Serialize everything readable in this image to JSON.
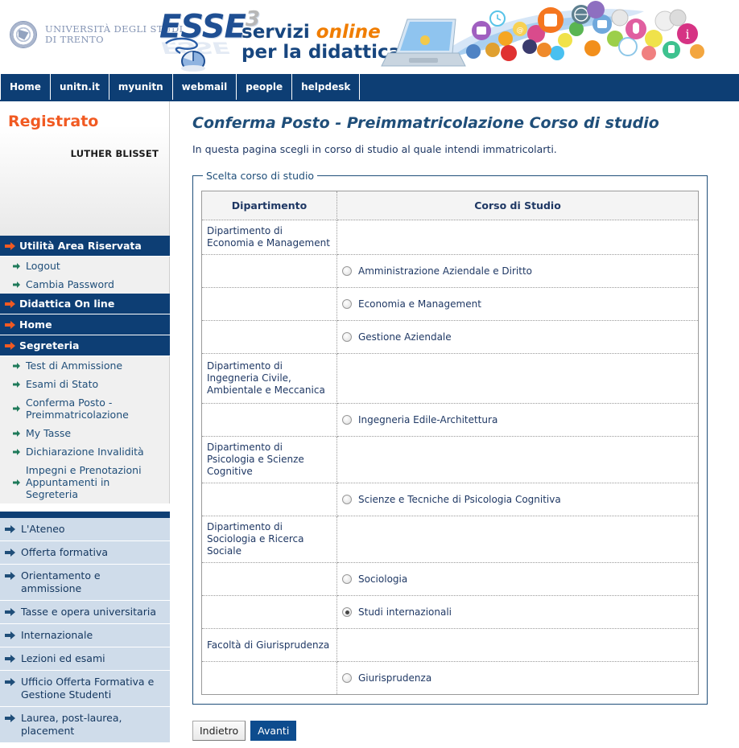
{
  "header": {
    "university_name_line1": "UNIVERSITÀ DEGLI STUDI",
    "university_name_line2": "DI TRENTO",
    "logo_word": "ESSE",
    "logo_sup": "3",
    "tagline_line1_plain": "servizi ",
    "tagline_line1_accent": "online",
    "tagline_line2": "per la didattica",
    "accent_color": "#f07d00",
    "brand_color": "#17467f"
  },
  "navbar": {
    "items": [
      {
        "label": "Home"
      },
      {
        "label": "unitn.it"
      },
      {
        "label": "myunitn"
      },
      {
        "label": "webmail"
      },
      {
        "label": "people"
      },
      {
        "label": "helpdesk"
      }
    ]
  },
  "sidebar": {
    "status_label": "Registrato",
    "status_color": "#f15a22",
    "user_name": "LUTHER BLISSET",
    "groups": [
      {
        "head": "Utilità Area Riservata",
        "items": [
          {
            "label": "Logout"
          },
          {
            "label": "Cambia Password"
          }
        ]
      },
      {
        "head": "Didattica On line",
        "items": []
      },
      {
        "head": "Home",
        "items": []
      },
      {
        "head": "Segreteria",
        "items": [
          {
            "label": "Test di Ammissione"
          },
          {
            "label": "Esami di Stato"
          },
          {
            "label": "Conferma Posto - Preimmatricolazione"
          },
          {
            "label": "My Tasse"
          },
          {
            "label": "Dichiarazione Invalidità"
          },
          {
            "label": "Impegni e Prenotazioni Appuntamenti in Segreteria"
          }
        ]
      }
    ],
    "links": [
      {
        "label": "L'Ateneo"
      },
      {
        "label": "Offerta formativa"
      },
      {
        "label": "Orientamento e ammissione"
      },
      {
        "label": "Tasse e opera universitaria"
      },
      {
        "label": "Internazionale"
      },
      {
        "label": "Lezioni ed esami"
      },
      {
        "label": "Ufficio Offerta Formativa e Gestione Studenti"
      },
      {
        "label": "Laurea, post-laurea, placement"
      }
    ]
  },
  "main": {
    "title": "Conferma Posto - Preimmatricolazione Corso di studio",
    "intro": "In questa pagina scegli in corso di studio al quale intendi immatricolarti.",
    "fieldset_legend": "Scelta corso di studio",
    "table": {
      "headers": [
        "Dipartimento",
        "Corso di Studio"
      ],
      "rows": [
        {
          "type": "dept",
          "dipartimento": "Dipartimento di Economia e Management",
          "corso": "",
          "selected": false
        },
        {
          "type": "course",
          "dipartimento": "",
          "corso": "Amministrazione Aziendale e Diritto",
          "selected": false
        },
        {
          "type": "course",
          "dipartimento": "",
          "corso": "Economia e Management",
          "selected": false
        },
        {
          "type": "course",
          "dipartimento": "",
          "corso": "Gestione Aziendale",
          "selected": false
        },
        {
          "type": "dept",
          "dipartimento": "Dipartimento di Ingegneria Civile, Ambientale e Meccanica",
          "corso": "",
          "selected": false
        },
        {
          "type": "course",
          "dipartimento": "",
          "corso": "Ingegneria Edile-Architettura",
          "selected": false
        },
        {
          "type": "dept",
          "dipartimento": "Dipartimento di Psicologia e Scienze Cognitive",
          "corso": "",
          "selected": false
        },
        {
          "type": "course",
          "dipartimento": "",
          "corso": "Scienze e Tecniche di Psicologia Cognitiva",
          "selected": false
        },
        {
          "type": "dept",
          "dipartimento": "Dipartimento di Sociologia e Ricerca Sociale",
          "corso": "",
          "selected": false
        },
        {
          "type": "course",
          "dipartimento": "",
          "corso": "Sociologia",
          "selected": false
        },
        {
          "type": "course",
          "dipartimento": "",
          "corso": "Studi internazionali",
          "selected": true
        },
        {
          "type": "dept",
          "dipartimento": "Facoltà di Giurisprudenza",
          "corso": "",
          "selected": false
        },
        {
          "type": "course",
          "dipartimento": "",
          "corso": "Giurisprudenza",
          "selected": false
        }
      ]
    },
    "buttons": {
      "back": "Indietro",
      "next": "Avanti"
    }
  }
}
